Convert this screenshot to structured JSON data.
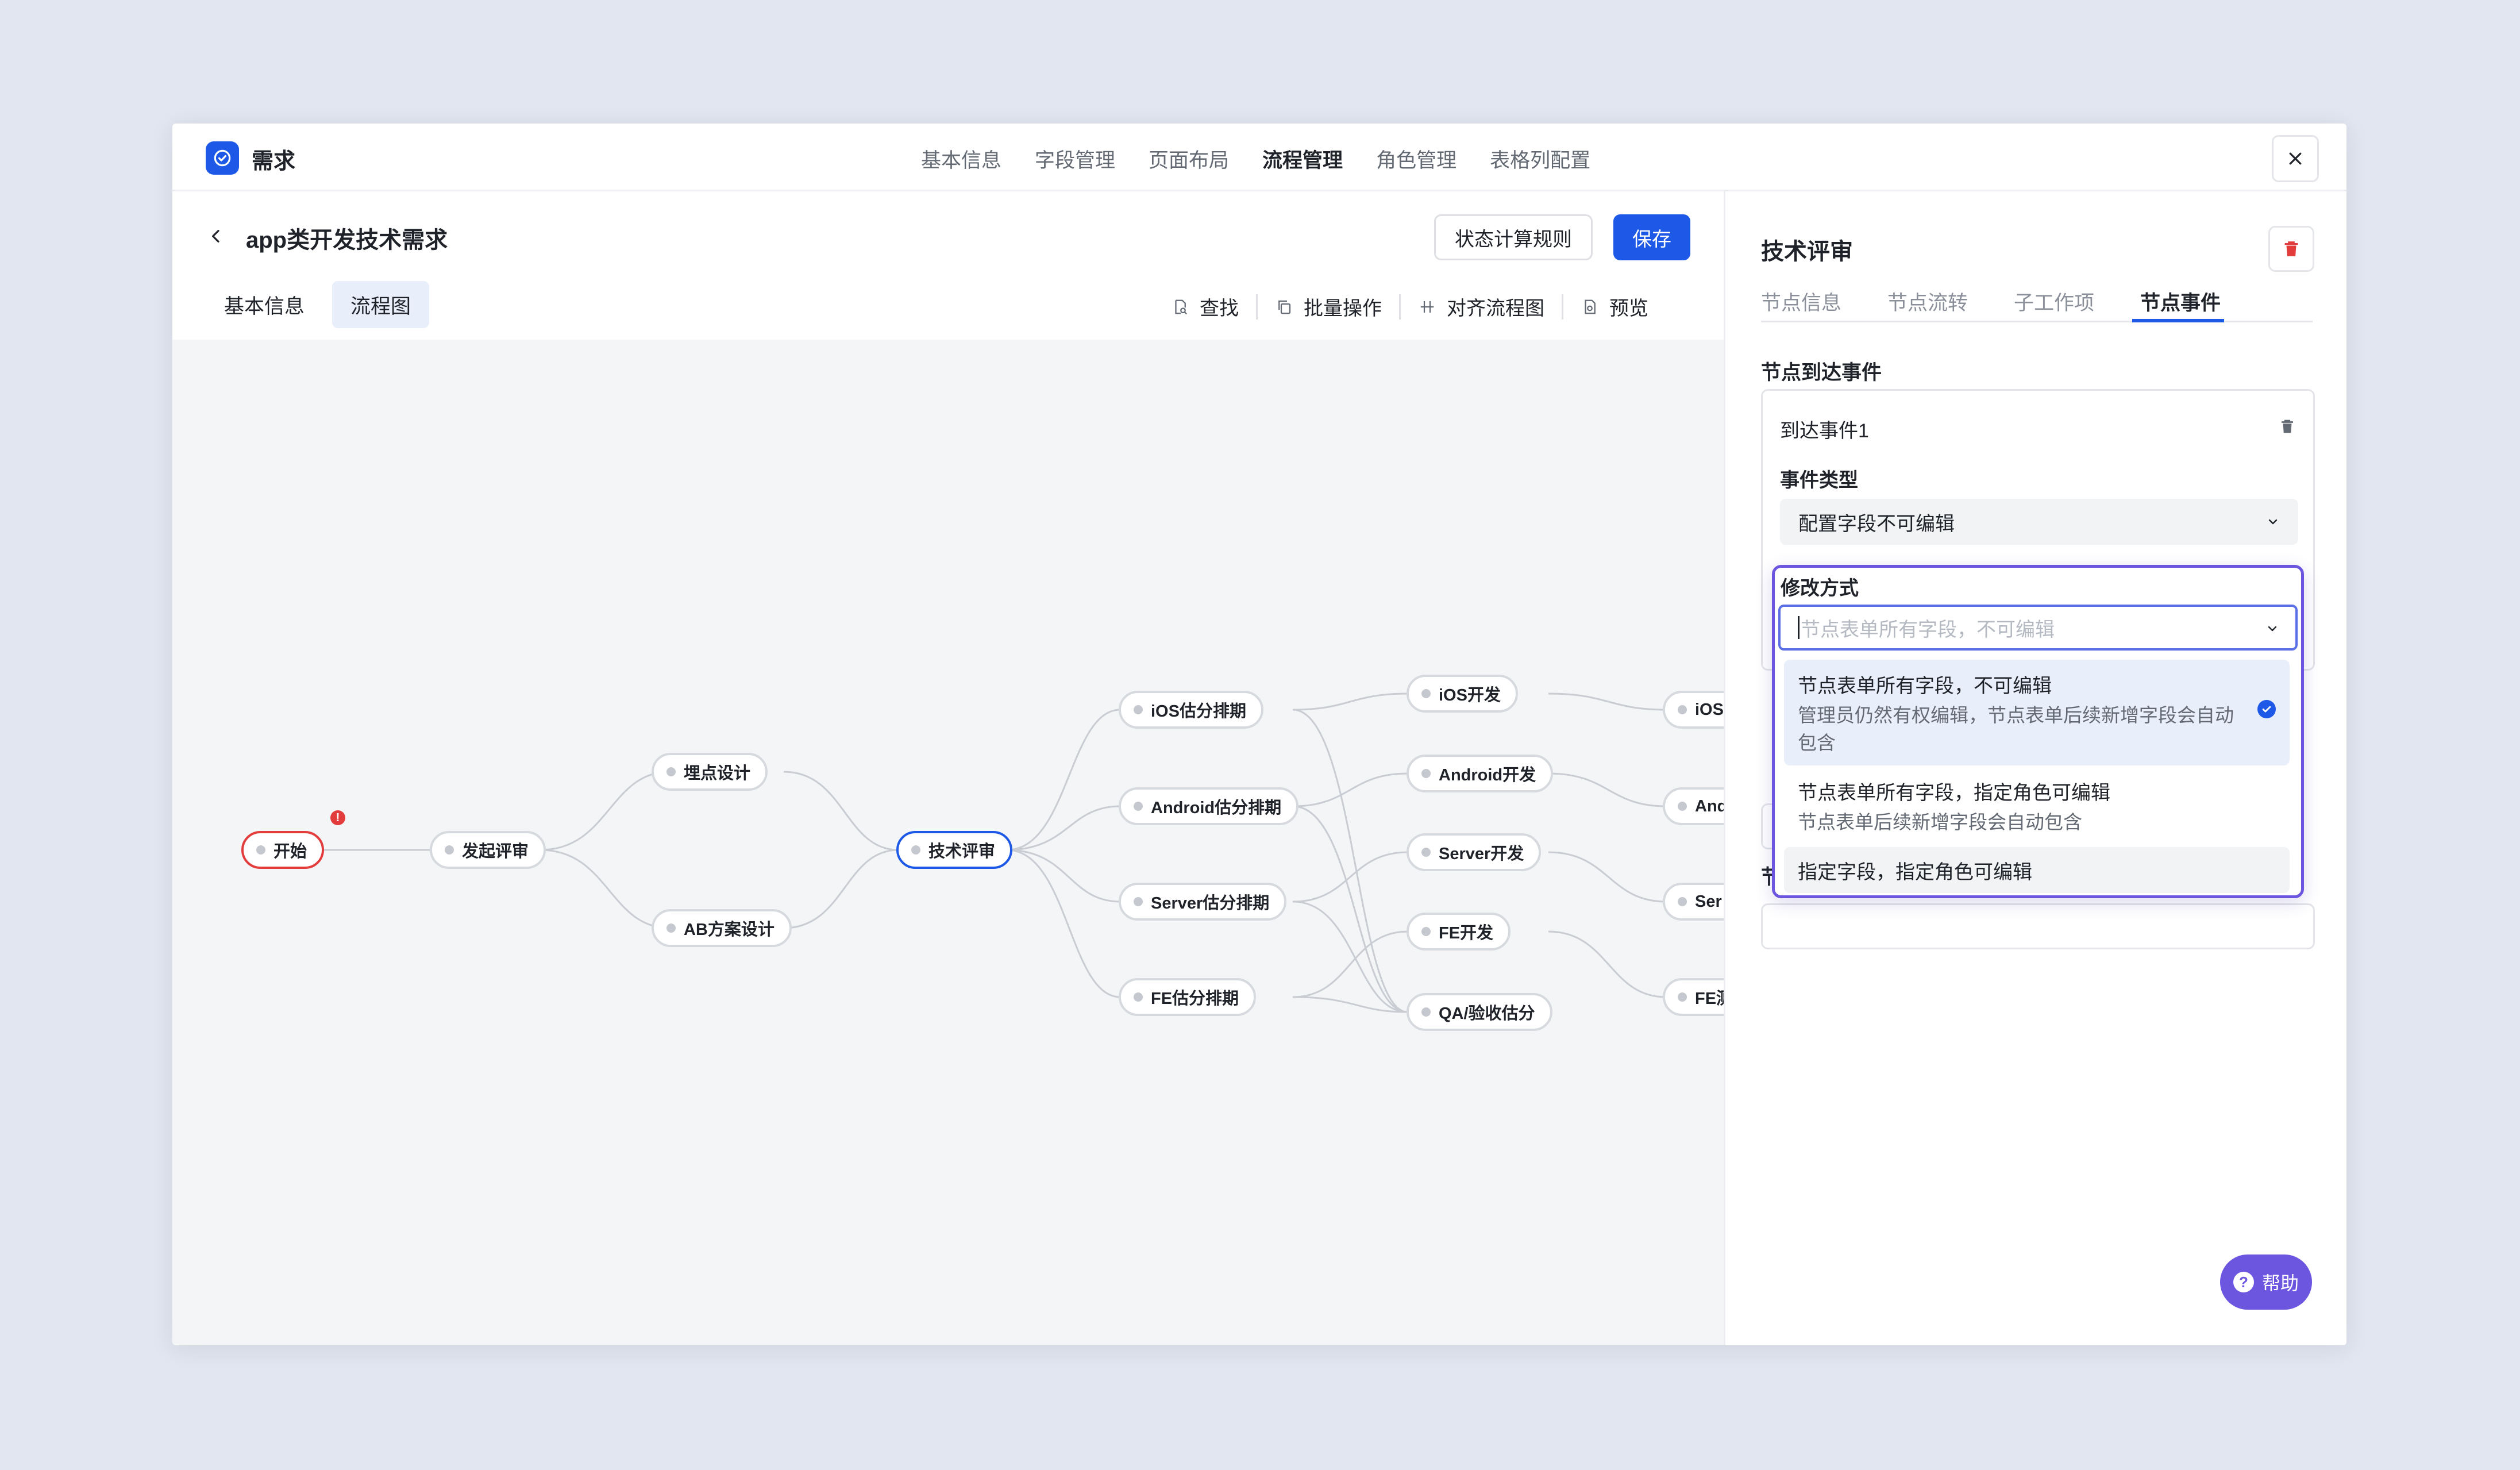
{
  "app": {
    "name": "需求"
  },
  "topnav": {
    "items": [
      "基本信息",
      "字段管理",
      "页面布局",
      "流程管理",
      "角色管理",
      "表格列配置"
    ],
    "active": "流程管理"
  },
  "page": {
    "title": "app类开发技术需求",
    "rule_button": "状态计算规则",
    "save_button": "保存",
    "subtabs": [
      "基本信息",
      "流程图"
    ],
    "active_subtab": "流程图"
  },
  "toolbar": {
    "find": "查找",
    "batch": "批量操作",
    "align": "对齐流程图",
    "preview": "预览"
  },
  "flow": {
    "nodes": {
      "start": "开始",
      "initiate": "发起评审",
      "tracking": "埋点设计",
      "ab": "AB方案设计",
      "tech": "技术评审",
      "ios_est": "iOS估分排期",
      "android_est": "Android估分排期",
      "server_est": "Server估分排期",
      "fe_est": "FE估分排期",
      "ios_dev": "iOS开发",
      "android_dev": "Android开发",
      "server_dev": "Server开发",
      "fe_dev": "FE开发",
      "qa": "QA/验收估分",
      "ios_next": "iOS",
      "android_next": "And",
      "server_next": "Ser",
      "fe_next": "FE测"
    },
    "warning": "!"
  },
  "panel": {
    "title": "技术评审",
    "tabs": [
      "节点信息",
      "节点流转",
      "子工作项",
      "节点事件"
    ],
    "active_tab": "节点事件",
    "section_title": "节点到达事件",
    "event_name": "到达事件1",
    "event_type_label": "事件类型",
    "event_type_value": "配置字段不可编辑",
    "stub_section": "节"
  },
  "dropdown": {
    "label": "修改方式",
    "placeholder": "节点表单所有字段，不可编辑",
    "options": [
      {
        "title": "节点表单所有字段，不可编辑",
        "desc": "管理员仍然有权编辑，节点表单后续新增字段会自动包含"
      },
      {
        "title": "节点表单所有字段，指定角色可编辑",
        "desc": "节点表单后续新增字段会自动包含"
      },
      {
        "title": "指定字段，指定角色可编辑",
        "desc": ""
      }
    ],
    "selected_index": 0
  },
  "help": {
    "label": "帮助"
  },
  "colors": {
    "brand": "#1d58e6",
    "accent": "#6c56e0",
    "danger": "#e23c3c"
  }
}
